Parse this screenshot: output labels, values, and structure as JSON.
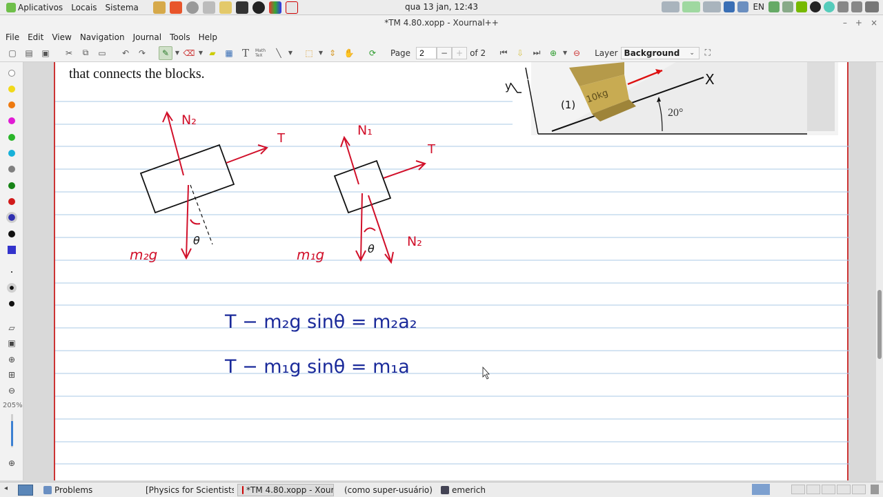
{
  "top_panel": {
    "apps_label": "Aplicativos",
    "places_label": "Locais",
    "system_label": "Sistema",
    "clock": "qua 13 jan, 12:43",
    "keyboard_layout": "EN",
    "launchers": [
      "folder-icon",
      "brave-icon",
      "search-icon",
      "calculator-icon",
      "text-editor-icon",
      "terminal-icon",
      "steam-icon",
      "gnome-icon",
      "xournal-icon"
    ]
  },
  "window": {
    "title": "*TM 4.80.xopp - Xournal++",
    "controls": [
      "–",
      "+",
      "×"
    ]
  },
  "menu": [
    "File",
    "Edit",
    "View",
    "Navigation",
    "Journal",
    "Tools",
    "Help"
  ],
  "toolbar": {
    "page_label": "Page",
    "page_value": "2",
    "page_of": "of 2",
    "minus": "−",
    "plus": "+",
    "layer_label": "Layer",
    "layer_value": "Background",
    "tex_label": "Math TeX"
  },
  "sidebar": {
    "colors": [
      "#ffffff",
      "#f1d91a",
      "#ee7a10",
      "#e01bd4",
      "#2ab52a",
      "#17b1d9",
      "#808080",
      "#178317",
      "#d11a1a",
      "#3030b0",
      "#111111",
      "#3333cc"
    ],
    "zoom": "205%"
  },
  "document": {
    "text_line": "that connects the blocks.",
    "incline_angle": "20°",
    "incline_label_x": "X",
    "incline_label_y": "y",
    "incline_mass": "10kg",
    "incline_block_num": "(1)",
    "fbd2_normal": "N₂",
    "fbd2_tension": "T",
    "fbd2_weight": "m₂g",
    "fbd2_angle": "θ",
    "fbd1_normal": "N₁",
    "fbd1_tension": "T",
    "fbd1_weight": "m₁g",
    "fbd1_normal2": "N₂",
    "fbd1_angle": "θ",
    "eq1": "T − m₂g sinθ = m₂a₂",
    "eq2": "T − m₁g sinθ = m₁a"
  },
  "taskbar": {
    "tasks": [
      {
        "label": "Problems",
        "active": false
      },
      {
        "label": "[Physics for Scientists a...",
        "active": false
      },
      {
        "label": "*TM 4.80.xopp - Xourn...",
        "active": true
      },
      {
        "label": "(como super-usuário)",
        "active": false
      },
      {
        "label": "emerich",
        "active": false
      }
    ]
  }
}
